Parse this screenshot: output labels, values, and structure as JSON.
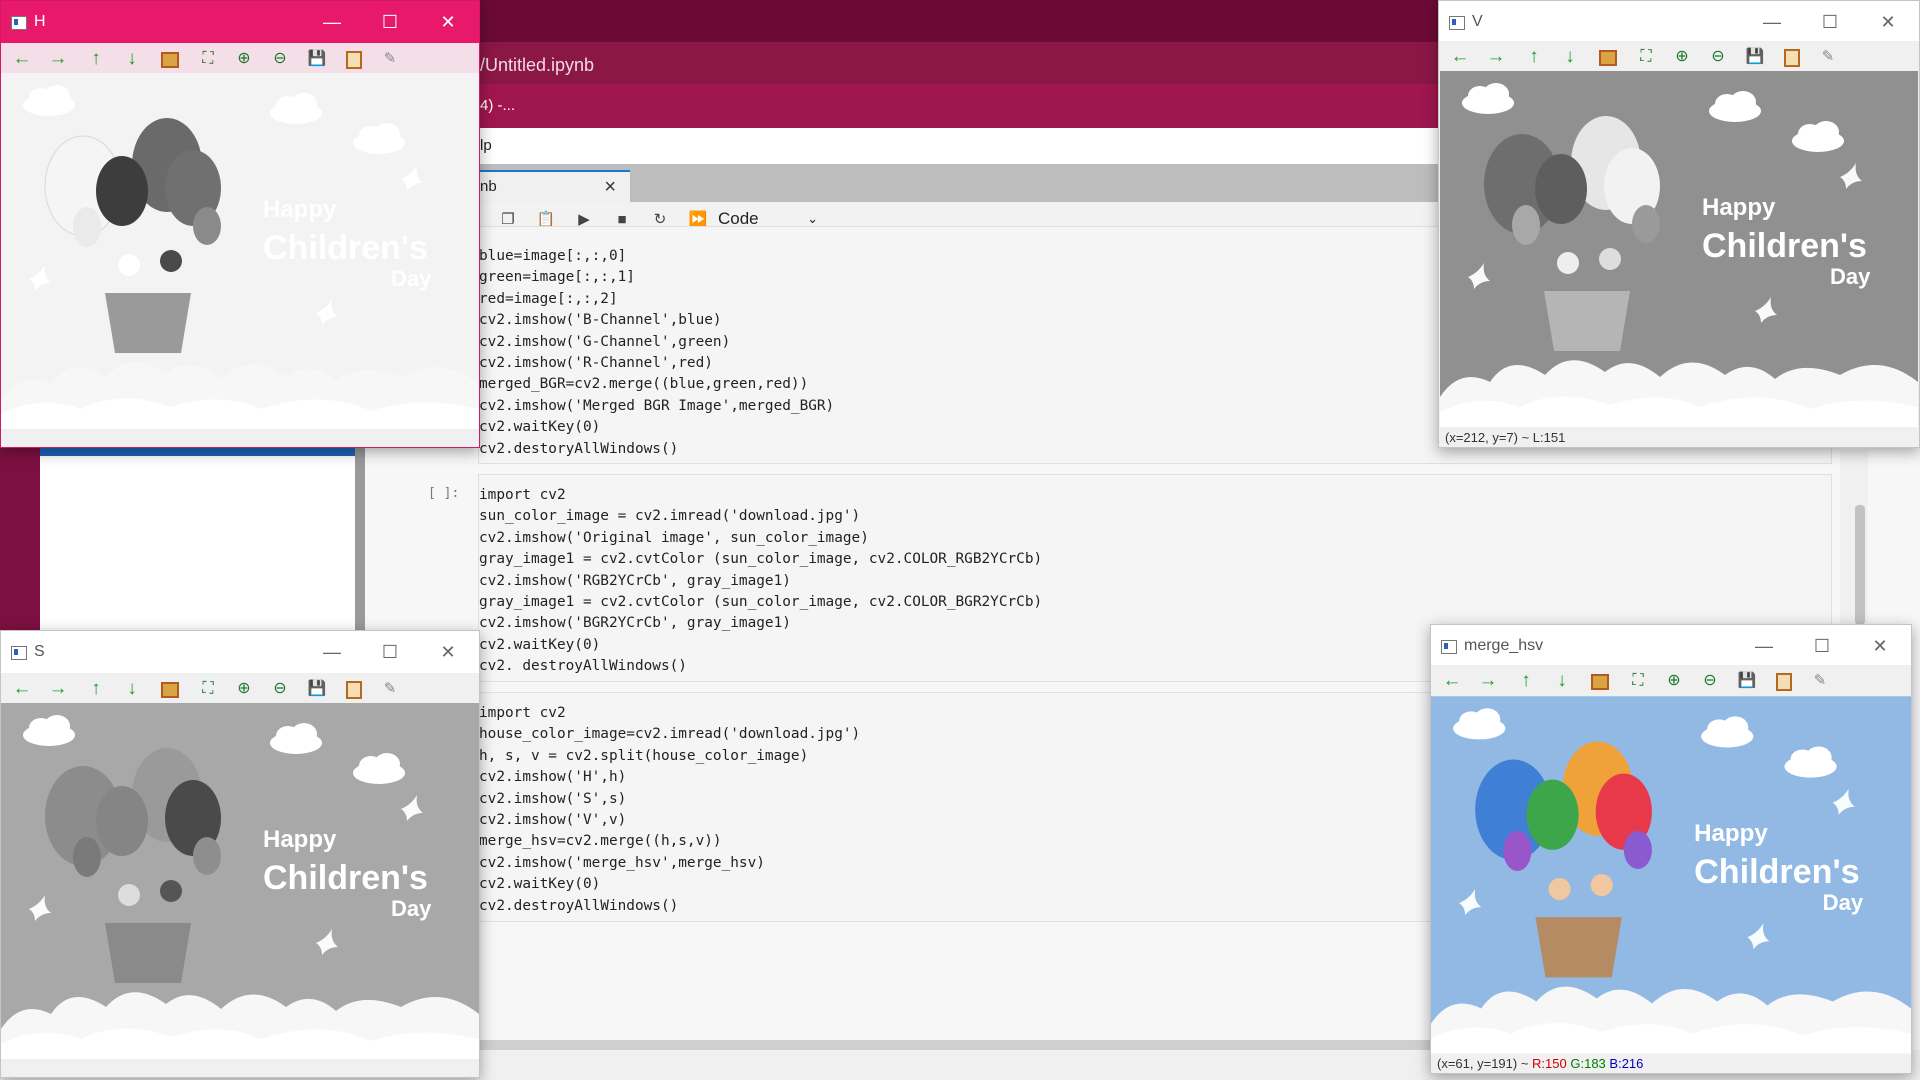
{
  "jupyter": {
    "title": "/Untitled.ipynb",
    "menu_fragment": "4) -...",
    "search_fragment": "lp",
    "tab_label": "nb",
    "kernel_mode": "Code",
    "cells": [
      {
        "prompt": "",
        "lines": [
          "blue=image[:,:,0]",
          "green=image[:,:,1]",
          "red=image[:,:,2]",
          "cv2.imshow('B-Channel',blue)",
          "cv2.imshow('G-Channel',green)",
          "cv2.imshow('R-Channel',red)",
          "merged_BGR=cv2.merge((blue,green,red))",
          "cv2.imshow('Merged BGR Image',merged_BGR)",
          "cv2.waitKey(0)",
          "cv2.destoryAllWindows()"
        ]
      },
      {
        "prompt": "[ ]:",
        "lines": [
          "import cv2",
          "sun_color_image = cv2.imread('download.jpg')",
          "cv2.imshow('Original image', sun_color_image)",
          "gray_image1 = cv2.cvtColor (sun_color_image, cv2.COLOR_RGB2YCrCb)",
          "cv2.imshow('RGB2YCrCb', gray_image1)",
          "gray_image1 = cv2.cvtColor (sun_color_image, cv2.COLOR_BGR2YCrCb)",
          "cv2.imshow('BGR2YCrCb', gray_image1)",
          "cv2.waitKey(0)",
          "cv2. destroyAllWindows()"
        ]
      },
      {
        "prompt": "",
        "lines": [
          "import cv2",
          "house_color_image=cv2.imread('download.jpg')",
          "h, s, v = cv2.split(house_color_image)",
          "cv2.imshow('H',h)",
          "cv2.imshow('S',s)",
          "cv2.imshow('V',v)",
          "merge_hsv=cv2.merge((h,s,v))",
          "cv2.imshow('merge_hsv',merge_hsv)",
          "cv2.waitKey(0)",
          "cv2.destroyAllWindows()"
        ]
      }
    ]
  },
  "image_text": {
    "line1": "Happy",
    "line2": "Children's",
    "line3": "Day"
  },
  "windows": {
    "h": {
      "title": "H",
      "status": ""
    },
    "s": {
      "title": "S",
      "status": ""
    },
    "v": {
      "title": "V",
      "status": "(x=212, y=7) ~ L:151"
    },
    "merge_hsv": {
      "title": "merge_hsv",
      "status_prefix": "(x=61, y=191) ~",
      "status_r": "R:150",
      "status_g": "G:183",
      "status_b": "B:216"
    }
  },
  "colors": {
    "accent": "#e8186a",
    "sky_blue": "#92b9e4",
    "gray_bg": "#a8a8a8",
    "gray_bg_v": "#909090"
  }
}
